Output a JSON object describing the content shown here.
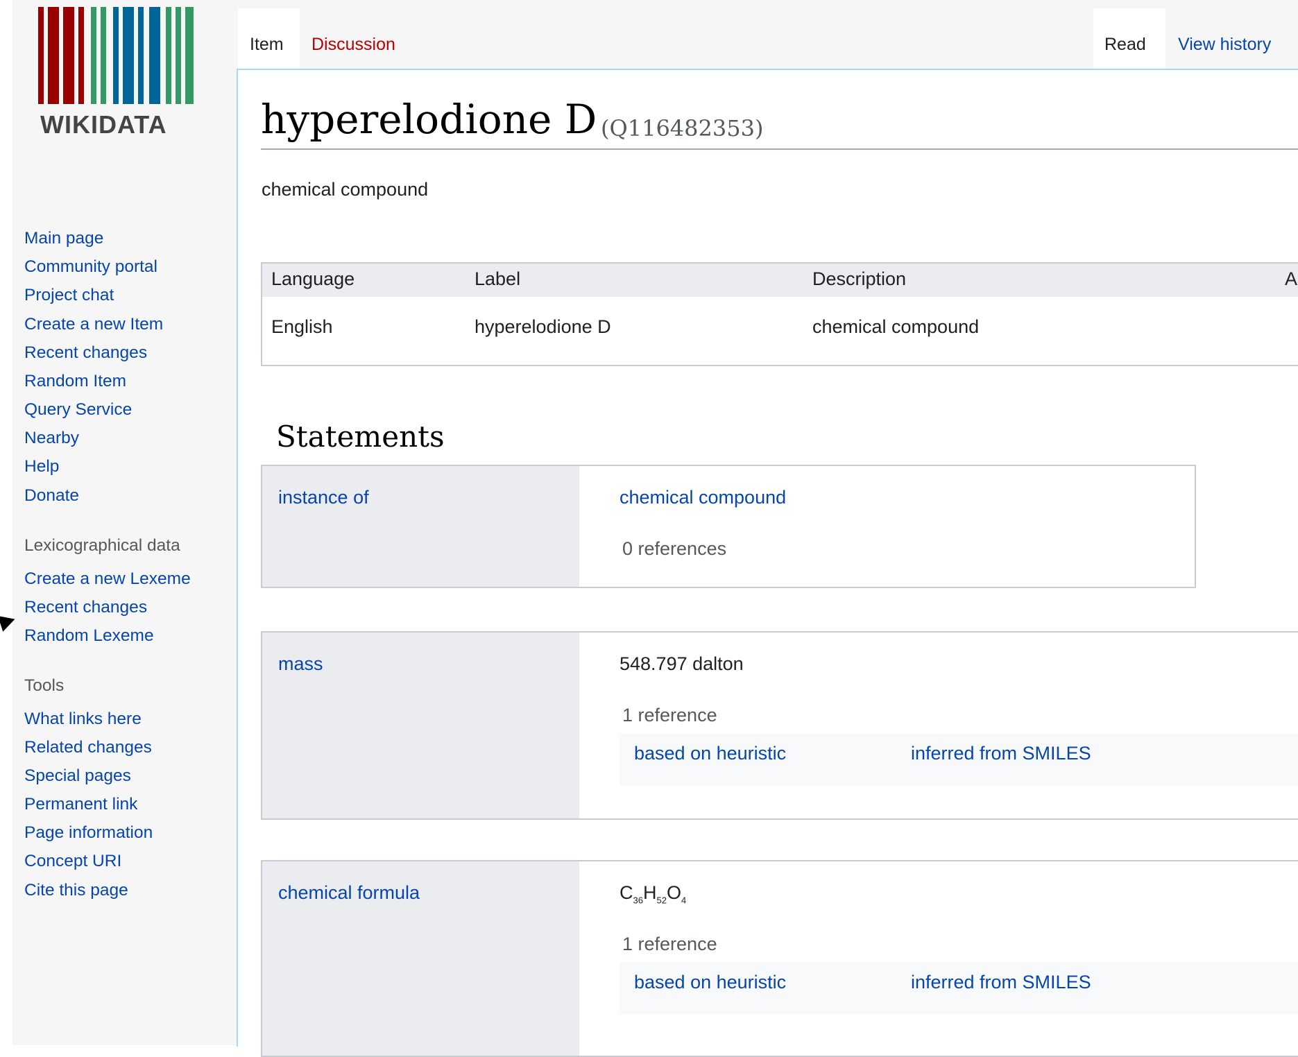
{
  "logo": {
    "text": "WIKIDATA",
    "bar_colors": [
      "#990000",
      "#339966",
      "#006699"
    ]
  },
  "sidebar": {
    "nav": [
      "Main page",
      "Community portal",
      "Project chat",
      "Create a new Item",
      "Recent changes",
      "Random Item",
      "Query Service",
      "Nearby",
      "Help",
      "Donate"
    ],
    "lex_heading": "Lexicographical data",
    "lex": [
      "Create a new Lexeme",
      "Recent changes",
      "Random Lexeme"
    ],
    "tools_heading": "Tools",
    "tools": [
      "What links here",
      "Related changes",
      "Special pages",
      "Permanent link",
      "Page information",
      "Concept URI",
      "Cite this page"
    ]
  },
  "tabs": {
    "item": "Item",
    "discussion": "Discussion",
    "read": "Read",
    "history": "View history"
  },
  "page": {
    "title": "hyperelodione D",
    "qid": "(Q116482353)",
    "description": "chemical compound"
  },
  "lang_table": {
    "headers": [
      "Language",
      "Label",
      "Description",
      "A"
    ],
    "row": [
      "English",
      "hyperelodione D",
      "chemical compound"
    ]
  },
  "statements": {
    "heading": "Statements",
    "items": [
      {
        "property": "instance of",
        "value": "chemical compound",
        "refs": "0 references"
      },
      {
        "property": "mass",
        "value": "548.797 dalton",
        "refs": "1 reference",
        "ref_property": "based on heuristic",
        "ref_value": "inferred from SMILES"
      },
      {
        "property": "chemical formula",
        "formula": {
          "c": "C",
          "c_n": "36",
          "h": "H",
          "h_n": "52",
          "o": "O",
          "o_n": "4"
        },
        "refs": "1 reference",
        "ref_property": "based on heuristic",
        "ref_value": "inferred from SMILES"
      }
    ]
  }
}
